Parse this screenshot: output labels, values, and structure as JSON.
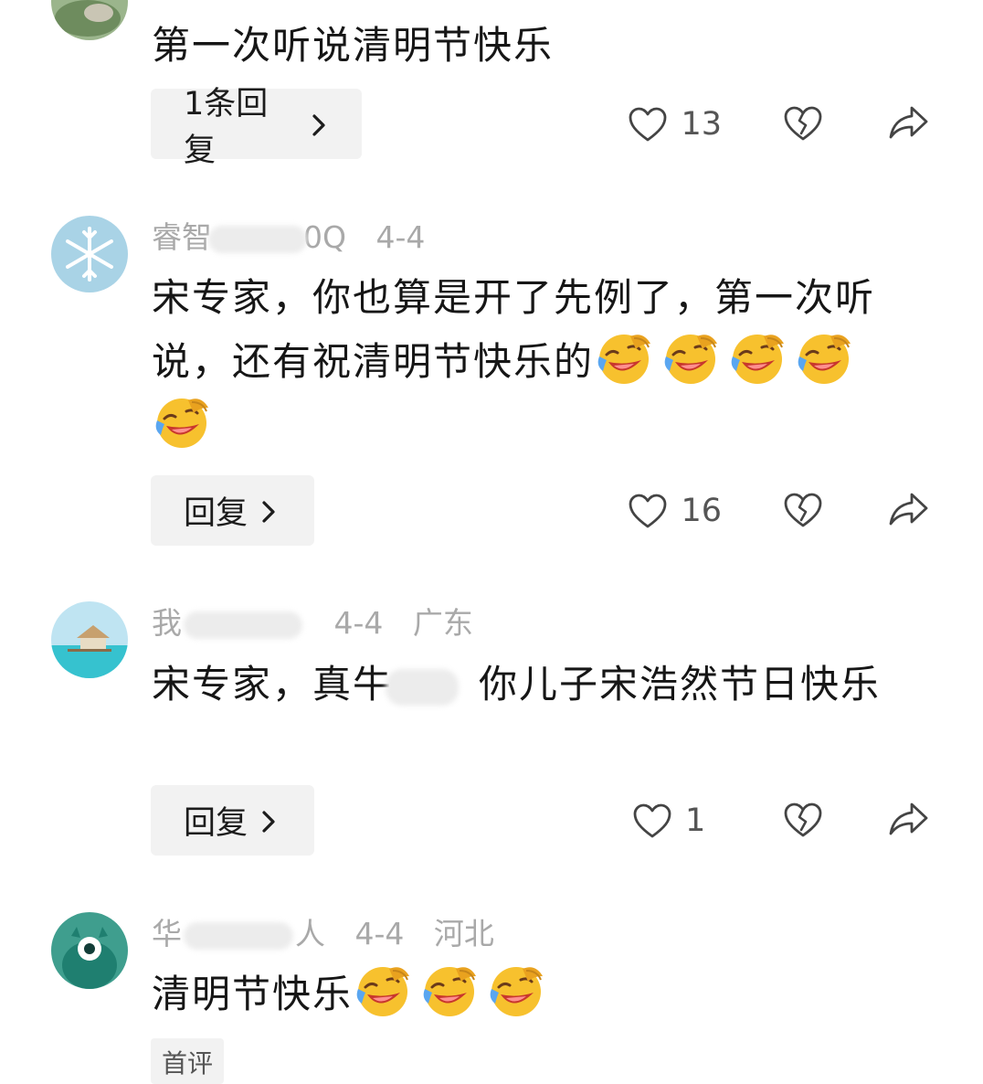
{
  "comments": [
    {
      "text": "第一次听说清明节快乐",
      "reply_label": "1条回复",
      "likes": "13"
    },
    {
      "user_visible": "睿智",
      "user_visible_tail": "0Q",
      "date": "4-4",
      "text_line": "宋专家，你也算是开了先例了，第一次听说，还有祝清明节快乐的",
      "emoji_count": 5,
      "emoji": "rolling-laugh-emoji",
      "reply_label": "回复",
      "likes": "16"
    },
    {
      "user_visible": "我",
      "date": "4-4",
      "location": "广东",
      "text_a": "宋专家，真牛",
      "text_b": "你儿子宋浩然节日快乐",
      "reply_label": "回复",
      "likes": "1"
    },
    {
      "user_visible": "华",
      "user_visible_tail": "人",
      "date": "4-4",
      "location": "河北",
      "text": "清明节快乐",
      "emoji_count": 3,
      "emoji": "rolling-laugh-emoji",
      "tag": "首评"
    }
  ],
  "icons": {
    "like": "heart-outline-icon",
    "dislike": "broken-heart-icon",
    "share": "share-arrow-icon",
    "chevron": "chevron-right-icon"
  },
  "colors": {
    "meta_text": "#a9a9a9",
    "button_bg": "#f2f2f2",
    "emoji_face": "#f7c12e"
  }
}
